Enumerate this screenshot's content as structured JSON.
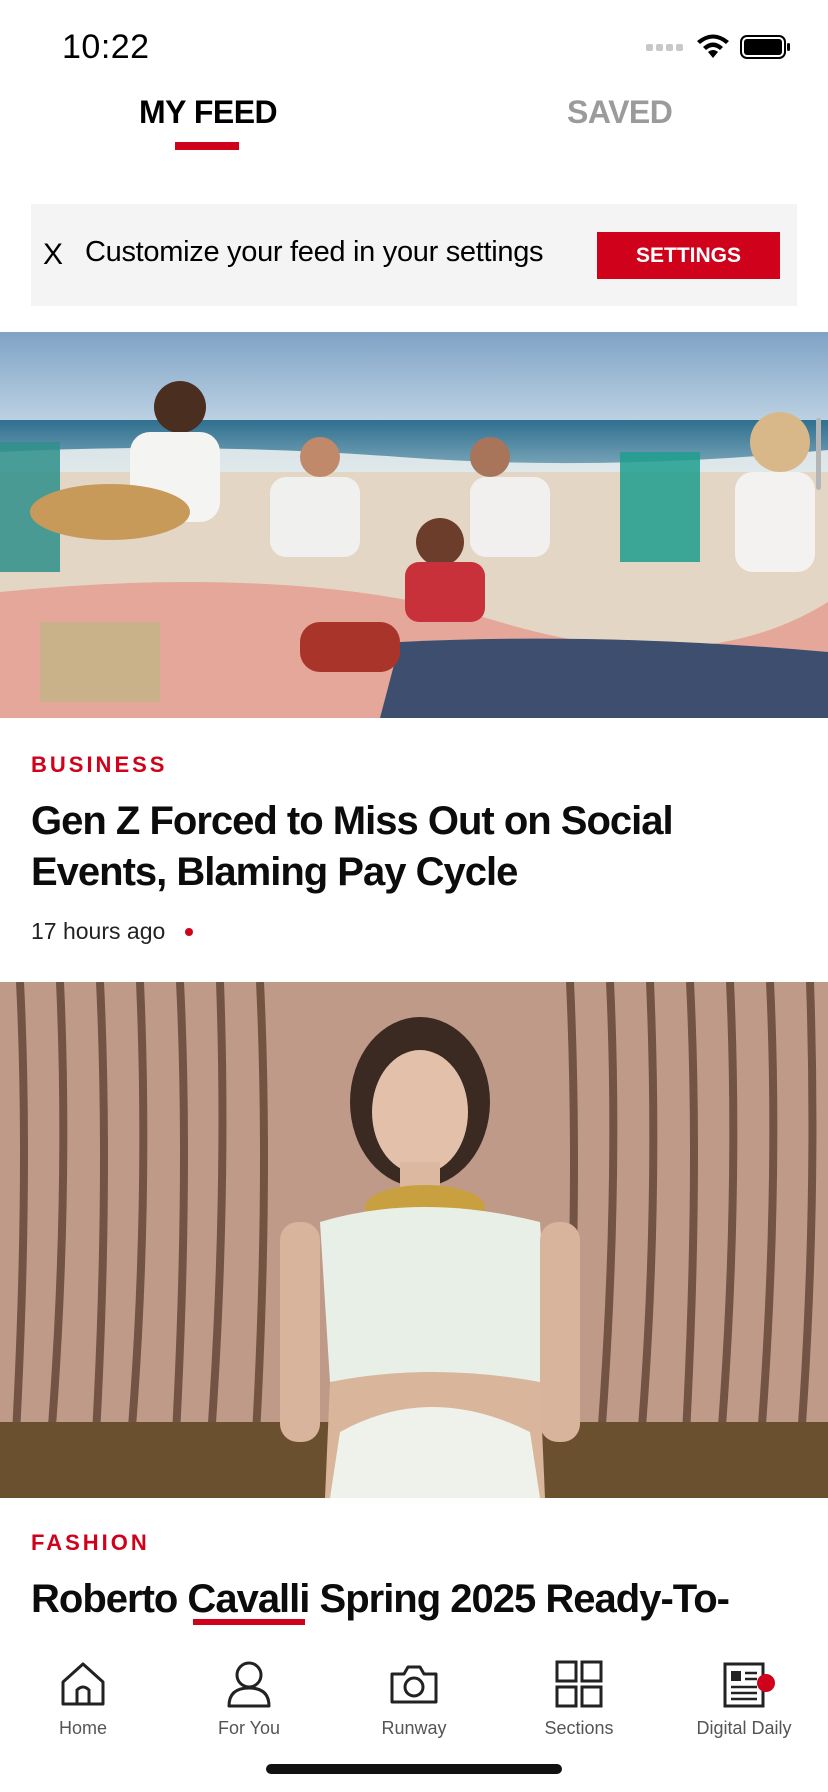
{
  "status_bar": {
    "time": "10:22"
  },
  "tabs": {
    "my_feed": "MY FEED",
    "saved": "SAVED"
  },
  "banner": {
    "close_label": "X",
    "text": "Customize your feed in your settings",
    "button_label": "SETTINGS"
  },
  "articles": [
    {
      "category": "BUSINESS",
      "headline": "Gen Z Forced to Miss Out on Social Events, Blaming Pay Cycle",
      "timestamp": "17 hours ago"
    },
    {
      "category": "FASHION",
      "headline": "Roberto Cavalli Spring 2025 Ready-To-"
    }
  ],
  "bottom_nav": {
    "items": [
      {
        "label": "Home",
        "icon": "home-icon"
      },
      {
        "label": "For You",
        "icon": "person-icon"
      },
      {
        "label": "Runway",
        "icon": "camera-icon"
      },
      {
        "label": "Sections",
        "icon": "grid-icon"
      },
      {
        "label": "Digital Daily",
        "icon": "newspaper-icon"
      }
    ]
  },
  "colors": {
    "accent": "#d0021b",
    "inactive_tab": "#9b9b9b",
    "banner_bg": "#f4f4f4"
  }
}
